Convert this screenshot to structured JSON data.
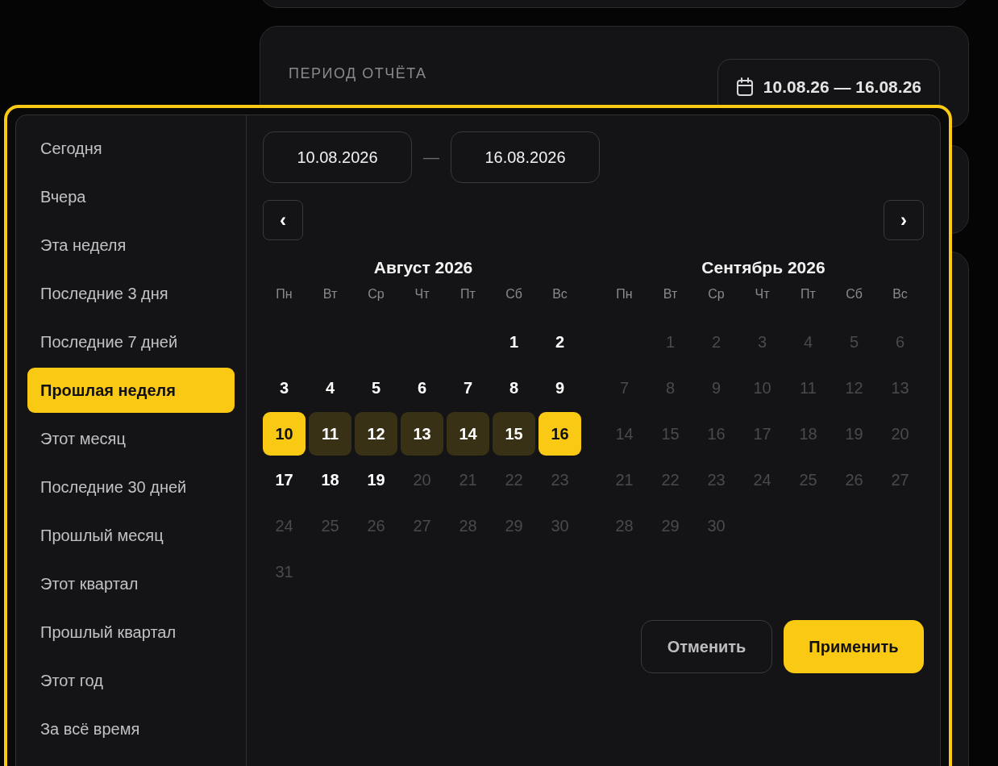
{
  "report_period": {
    "label": "ПЕРИОД ОТЧЁТА",
    "button": "10.08.26 — 16.08.26"
  },
  "picker": {
    "presets": [
      {
        "label": "Сегодня",
        "selected": false
      },
      {
        "label": "Вчера",
        "selected": false
      },
      {
        "label": "Эта неделя",
        "selected": false
      },
      {
        "label": "Последние 3 дня",
        "selected": false
      },
      {
        "label": "Последние 7 дней",
        "selected": false
      },
      {
        "label": "Прошлая неделя",
        "selected": true
      },
      {
        "label": "Этот месяц",
        "selected": false
      },
      {
        "label": "Последние 30 дней",
        "selected": false
      },
      {
        "label": "Прошлый месяц",
        "selected": false
      },
      {
        "label": "Этот квартал",
        "selected": false
      },
      {
        "label": "Прошлый квартал",
        "selected": false
      },
      {
        "label": "Этот год",
        "selected": false
      },
      {
        "label": "За всё время",
        "selected": false
      }
    ],
    "start_input": "10.08.2026",
    "separator": "—",
    "end_input": "16.08.2026",
    "prev_button": "‹",
    "next_button": "›",
    "months": [
      {
        "title": "Август 2026",
        "weekdays": [
          "Пн",
          "Вт",
          "Ср",
          "Чт",
          "Пт",
          "Сб",
          "Вс"
        ],
        "weeks": [
          [
            {
              "kind": "empty"
            },
            {
              "kind": "empty"
            },
            {
              "kind": "empty"
            },
            {
              "kind": "empty"
            },
            {
              "kind": "empty"
            },
            {
              "day": "1",
              "kind": "available"
            },
            {
              "day": "2",
              "kind": "available"
            }
          ],
          [
            {
              "day": "3",
              "kind": "available"
            },
            {
              "day": "4",
              "kind": "available"
            },
            {
              "day": "5",
              "kind": "available"
            },
            {
              "day": "6",
              "kind": "available"
            },
            {
              "day": "7",
              "kind": "available"
            },
            {
              "day": "8",
              "kind": "available"
            },
            {
              "day": "9",
              "kind": "available"
            }
          ],
          [
            {
              "day": "10",
              "kind": "edge"
            },
            {
              "day": "11",
              "kind": "range"
            },
            {
              "day": "12",
              "kind": "range"
            },
            {
              "day": "13",
              "kind": "range"
            },
            {
              "day": "14",
              "kind": "range"
            },
            {
              "day": "15",
              "kind": "range"
            },
            {
              "day": "16",
              "kind": "edge"
            }
          ],
          [
            {
              "day": "17",
              "kind": "available"
            },
            {
              "day": "18",
              "kind": "available"
            },
            {
              "day": "19",
              "kind": "available"
            },
            {
              "day": "20",
              "kind": "disabled"
            },
            {
              "day": "21",
              "kind": "disabled"
            },
            {
              "day": "22",
              "kind": "disabled"
            },
            {
              "day": "23",
              "kind": "disabled"
            }
          ],
          [
            {
              "day": "24",
              "kind": "disabled"
            },
            {
              "day": "25",
              "kind": "disabled"
            },
            {
              "day": "26",
              "kind": "disabled"
            },
            {
              "day": "27",
              "kind": "disabled"
            },
            {
              "day": "28",
              "kind": "disabled"
            },
            {
              "day": "29",
              "kind": "disabled"
            },
            {
              "day": "30",
              "kind": "disabled"
            }
          ],
          [
            {
              "day": "31",
              "kind": "disabled"
            }
          ]
        ]
      },
      {
        "title": "Сентябрь 2026",
        "weekdays": [
          "Пн",
          "Вт",
          "Ср",
          "Чт",
          "Пт",
          "Сб",
          "Вс"
        ],
        "weeks": [
          [
            {
              "kind": "empty"
            },
            {
              "day": "1",
              "kind": "disabled"
            },
            {
              "day": "2",
              "kind": "disabled"
            },
            {
              "day": "3",
              "kind": "disabled"
            },
            {
              "day": "4",
              "kind": "disabled"
            },
            {
              "day": "5",
              "kind": "disabled"
            },
            {
              "day": "6",
              "kind": "disabled"
            }
          ],
          [
            {
              "day": "7",
              "kind": "disabled"
            },
            {
              "day": "8",
              "kind": "disabled"
            },
            {
              "day": "9",
              "kind": "disabled"
            },
            {
              "day": "10",
              "kind": "disabled"
            },
            {
              "day": "11",
              "kind": "disabled"
            },
            {
              "day": "12",
              "kind": "disabled"
            },
            {
              "day": "13",
              "kind": "disabled"
            }
          ],
          [
            {
              "day": "14",
              "kind": "disabled"
            },
            {
              "day": "15",
              "kind": "disabled"
            },
            {
              "day": "16",
              "kind": "disabled"
            },
            {
              "day": "17",
              "kind": "disabled"
            },
            {
              "day": "18",
              "kind": "disabled"
            },
            {
              "day": "19",
              "kind": "disabled"
            },
            {
              "day": "20",
              "kind": "disabled"
            }
          ],
          [
            {
              "day": "21",
              "kind": "disabled"
            },
            {
              "day": "22",
              "kind": "disabled"
            },
            {
              "day": "23",
              "kind": "disabled"
            },
            {
              "day": "24",
              "kind": "disabled"
            },
            {
              "day": "25",
              "kind": "disabled"
            },
            {
              "day": "26",
              "kind": "disabled"
            },
            {
              "day": "27",
              "kind": "disabled"
            }
          ],
          [
            {
              "day": "28",
              "kind": "disabled"
            },
            {
              "day": "29",
              "kind": "disabled"
            },
            {
              "day": "30",
              "kind": "disabled"
            }
          ]
        ]
      }
    ],
    "cancel_button": "Отменить",
    "apply_button": "Применить"
  }
}
